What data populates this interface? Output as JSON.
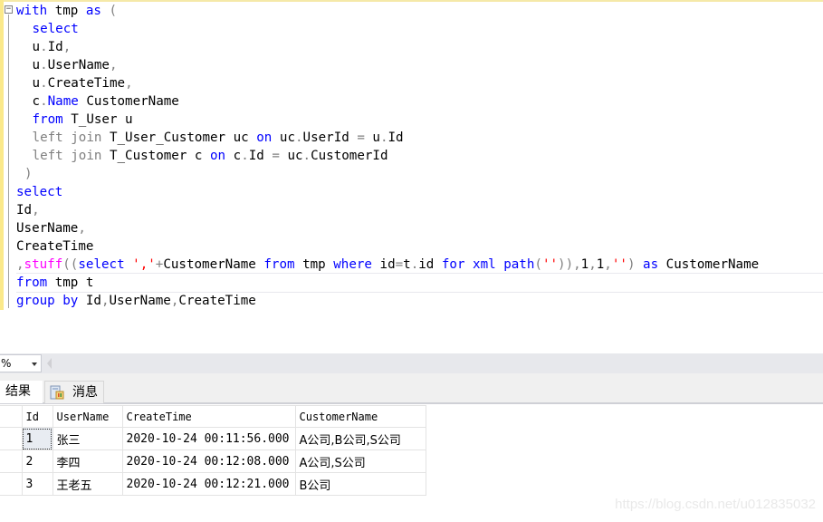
{
  "editor": {
    "lines": [
      [
        {
          "t": "with",
          "c": "kw"
        },
        {
          "t": " tmp "
        },
        {
          "t": "as",
          "c": "kw"
        },
        {
          "t": " (",
          "c": "gr"
        }
      ],
      [
        {
          "t": " "
        },
        {
          "t": "select",
          "c": "kw"
        }
      ],
      [
        {
          "t": " u"
        },
        {
          "t": ".",
          "c": "gr"
        },
        {
          "t": "Id"
        },
        {
          "t": ",",
          "c": "gr"
        }
      ],
      [
        {
          "t": " u"
        },
        {
          "t": ".",
          "c": "gr"
        },
        {
          "t": "UserName"
        },
        {
          "t": ",",
          "c": "gr"
        }
      ],
      [
        {
          "t": " u"
        },
        {
          "t": ".",
          "c": "gr"
        },
        {
          "t": "CreateTime"
        },
        {
          "t": ",",
          "c": "gr"
        }
      ],
      [
        {
          "t": " c"
        },
        {
          "t": ".",
          "c": "gr"
        },
        {
          "t": "Name",
          "c": "kw"
        },
        {
          "t": " CustomerName"
        }
      ],
      [
        {
          "t": " "
        },
        {
          "t": "from",
          "c": "kw"
        },
        {
          "t": " T_User u"
        }
      ],
      [
        {
          "t": " "
        },
        {
          "t": "left join",
          "c": "gr"
        },
        {
          "t": " T_User_Customer uc "
        },
        {
          "t": "on",
          "c": "kw"
        },
        {
          "t": " uc"
        },
        {
          "t": ".",
          "c": "gr"
        },
        {
          "t": "UserId "
        },
        {
          "t": "=",
          "c": "gr"
        },
        {
          "t": " u"
        },
        {
          "t": ".",
          "c": "gr"
        },
        {
          "t": "Id"
        }
      ],
      [
        {
          "t": " "
        },
        {
          "t": "left join",
          "c": "gr"
        },
        {
          "t": " T_Customer c "
        },
        {
          "t": "on",
          "c": "kw"
        },
        {
          "t": " c"
        },
        {
          "t": ".",
          "c": "gr"
        },
        {
          "t": "Id "
        },
        {
          "t": "=",
          "c": "gr"
        },
        {
          "t": " uc"
        },
        {
          "t": ".",
          "c": "gr"
        },
        {
          "t": "CustomerId"
        }
      ],
      [
        {
          "t": ")",
          "c": "gr"
        }
      ],
      [
        {
          "t": "select",
          "c": "kw"
        }
      ],
      [
        {
          "t": "Id"
        },
        {
          "t": ",",
          "c": "gr"
        }
      ],
      [
        {
          "t": "UserName"
        },
        {
          "t": ",",
          "c": "gr"
        }
      ],
      [
        {
          "t": "CreateTime"
        }
      ],
      [
        {
          "t": ",",
          "c": "gr"
        },
        {
          "t": "stuff",
          "c": "fn"
        },
        {
          "t": "((",
          "c": "gr"
        },
        {
          "t": "select",
          "c": "kw"
        },
        {
          "t": " "
        },
        {
          "t": "','",
          "c": "st"
        },
        {
          "t": "+",
          "c": "gr"
        },
        {
          "t": "CustomerName "
        },
        {
          "t": "from",
          "c": "kw"
        },
        {
          "t": " tmp "
        },
        {
          "t": "where",
          "c": "kw"
        },
        {
          "t": " id"
        },
        {
          "t": "=",
          "c": "gr"
        },
        {
          "t": "t"
        },
        {
          "t": ".",
          "c": "gr"
        },
        {
          "t": "id "
        },
        {
          "t": "for",
          "c": "kw"
        },
        {
          "t": " "
        },
        {
          "t": "xml",
          "c": "kw"
        },
        {
          "t": " "
        },
        {
          "t": "path",
          "c": "kw"
        },
        {
          "t": "(",
          "c": "gr"
        },
        {
          "t": "''",
          "c": "st"
        },
        {
          "t": ")),",
          "c": "gr"
        },
        {
          "t": "1"
        },
        {
          "t": ",",
          "c": "gr"
        },
        {
          "t": "1"
        },
        {
          "t": ",",
          "c": "gr"
        },
        {
          "t": "''",
          "c": "st"
        },
        {
          "t": ")",
          "c": "gr"
        },
        {
          "t": " "
        },
        {
          "t": "as",
          "c": "kw"
        },
        {
          "t": " CustomerName"
        }
      ],
      [
        {
          "t": "from",
          "c": "kw"
        },
        {
          "t": " tmp t"
        }
      ],
      [
        {
          "t": "group by",
          "c": "kw"
        },
        {
          "t": " Id"
        },
        {
          "t": ",",
          "c": "gr"
        },
        {
          "t": "UserName"
        },
        {
          "t": ",",
          "c": "gr"
        },
        {
          "t": "CreateTime"
        }
      ]
    ],
    "current_line": 15,
    "indented_lines": [
      1,
      2,
      3,
      4,
      5,
      6,
      7,
      8,
      9
    ]
  },
  "toolbar": {
    "zoom_value": "%"
  },
  "tabs": {
    "results": "结果",
    "messages": "消息"
  },
  "grid": {
    "columns": [
      "Id",
      "UserName",
      "CreateTime",
      "CustomerName"
    ],
    "rows": [
      {
        "id": "1",
        "user": "张三",
        "time": "2020-10-24 00:11:56.000",
        "customer": "A公司,B公司,S公司"
      },
      {
        "id": "2",
        "user": "李四",
        "time": "2020-10-24 00:12:08.000",
        "customer": "A公司,S公司"
      },
      {
        "id": "3",
        "user": "王老五",
        "time": "2020-10-24 00:12:21.000",
        "customer": "B公司"
      }
    ]
  },
  "watermark": "https://blog.csdn.net/u012835032"
}
